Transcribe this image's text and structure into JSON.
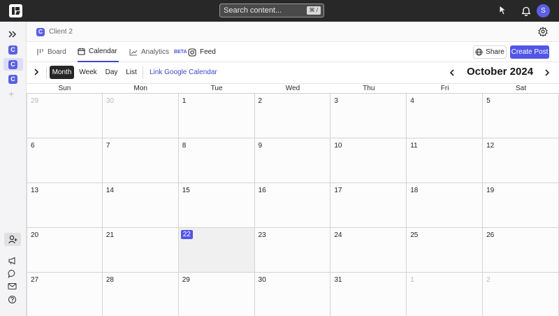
{
  "topbar": {
    "search_placeholder": "Search content...",
    "search_shortcut": "⌘ /",
    "avatar_initial": "S"
  },
  "sidebar": {
    "clients": [
      {
        "initial": "C",
        "active": false
      },
      {
        "initial": "C",
        "active": true
      },
      {
        "initial": "C",
        "active": false
      }
    ],
    "add_symbol": "+"
  },
  "header": {
    "client_initial": "C",
    "client_name": "Client 2"
  },
  "tabs": {
    "board": "Board",
    "calendar": "Calendar",
    "analytics": "Analytics",
    "analytics_badge": "BETA",
    "feed": "Feed",
    "share": "Share",
    "create_post": "Create Post"
  },
  "toolbar": {
    "views": [
      "Month",
      "Week",
      "Day",
      "List"
    ],
    "active_view": "Month",
    "link_google_calendar": "Link Google Calendar",
    "month_title": "October 2024"
  },
  "calendar": {
    "weekdays": [
      "Sun",
      "Mon",
      "Tue",
      "Wed",
      "Thu",
      "Fri",
      "Sat"
    ],
    "weeks": [
      [
        {
          "d": "29",
          "m": true
        },
        {
          "d": "30",
          "m": true
        },
        {
          "d": "1"
        },
        {
          "d": "2"
        },
        {
          "d": "3"
        },
        {
          "d": "4"
        },
        {
          "d": "5"
        }
      ],
      [
        {
          "d": "6"
        },
        {
          "d": "7"
        },
        {
          "d": "8"
        },
        {
          "d": "9"
        },
        {
          "d": "10"
        },
        {
          "d": "11"
        },
        {
          "d": "12"
        }
      ],
      [
        {
          "d": "13"
        },
        {
          "d": "14"
        },
        {
          "d": "15"
        },
        {
          "d": "16"
        },
        {
          "d": "17"
        },
        {
          "d": "18"
        },
        {
          "d": "19"
        }
      ],
      [
        {
          "d": "20"
        },
        {
          "d": "21"
        },
        {
          "d": "22",
          "today": true
        },
        {
          "d": "23"
        },
        {
          "d": "24"
        },
        {
          "d": "25"
        },
        {
          "d": "26"
        }
      ],
      [
        {
          "d": "27"
        },
        {
          "d": "28"
        },
        {
          "d": "29"
        },
        {
          "d": "30"
        },
        {
          "d": "31"
        },
        {
          "d": "1",
          "m": true
        },
        {
          "d": "2",
          "m": true
        }
      ]
    ]
  },
  "colors": {
    "accent": "#5155e8",
    "topbar": "#282828",
    "today_bg": "#f0f0f0"
  }
}
